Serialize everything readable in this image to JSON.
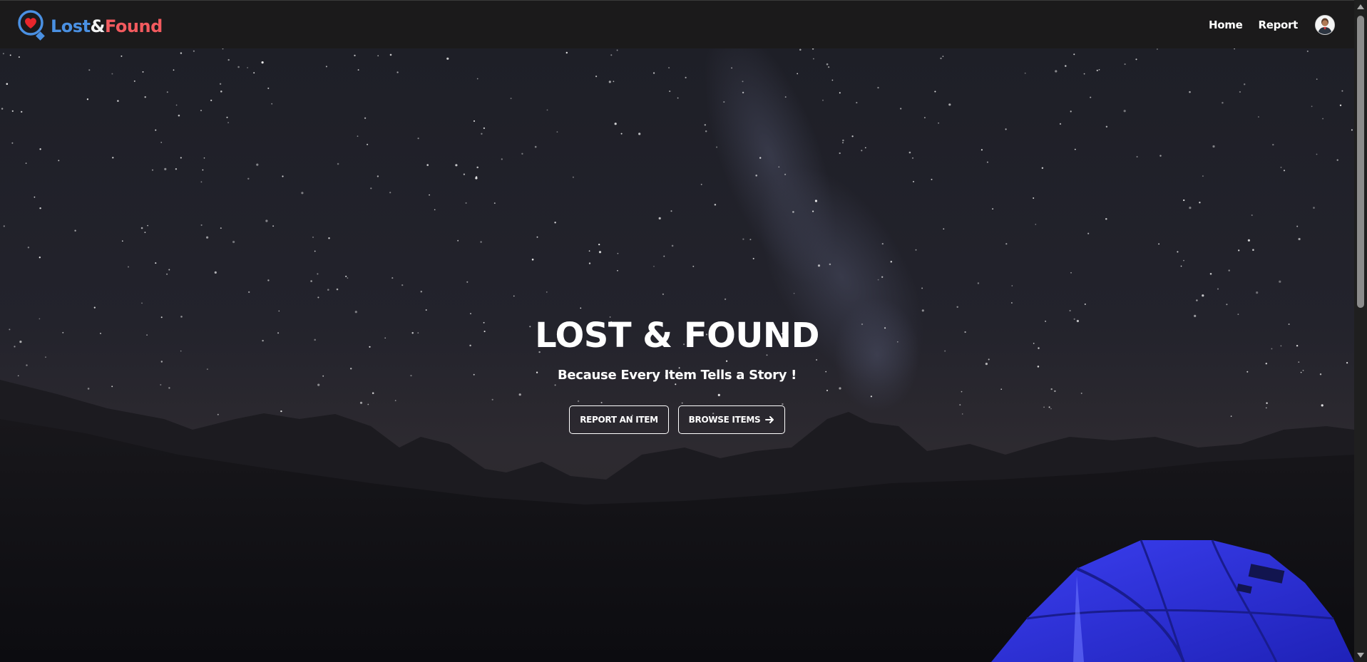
{
  "navbar": {
    "brand": {
      "lost": "Lost",
      "amp": "&",
      "found": "Found"
    },
    "links": [
      {
        "label": "Home"
      },
      {
        "label": "Report"
      }
    ],
    "logo_icon": "magnifier-heart-icon",
    "avatar_icon": "user-avatar"
  },
  "hero": {
    "title": "LOST & FOUND",
    "subtitle": "Because Every Item Tells a Story !",
    "buttons": {
      "report": "REPORT AN ITEM",
      "browse": "BROWSE ITEMS"
    },
    "browse_icon": "arrow-right-icon",
    "background": "night-sky-mountains-tent"
  },
  "colors": {
    "brand_lost": "#4a90e2",
    "brand_found": "#f25a5e",
    "navbar_bg": "#1b1a1b",
    "tent": "#2b2fd0"
  }
}
